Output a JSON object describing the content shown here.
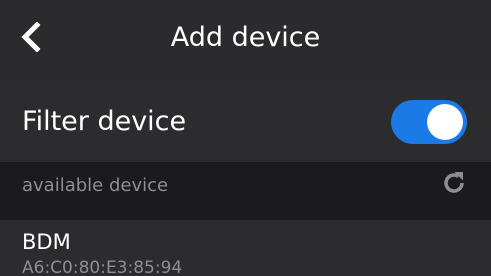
{
  "header": {
    "title": "Add device",
    "back_icon": "chevron-left-icon"
  },
  "filter": {
    "label": "Filter device",
    "enabled": true,
    "accent_color": "#1a7ae6"
  },
  "section": {
    "label": "available device",
    "refresh_icon": "refresh-icon"
  },
  "devices": [
    {
      "name": "BDM",
      "mac": "A6:C0:80:E3:85:94"
    }
  ]
}
